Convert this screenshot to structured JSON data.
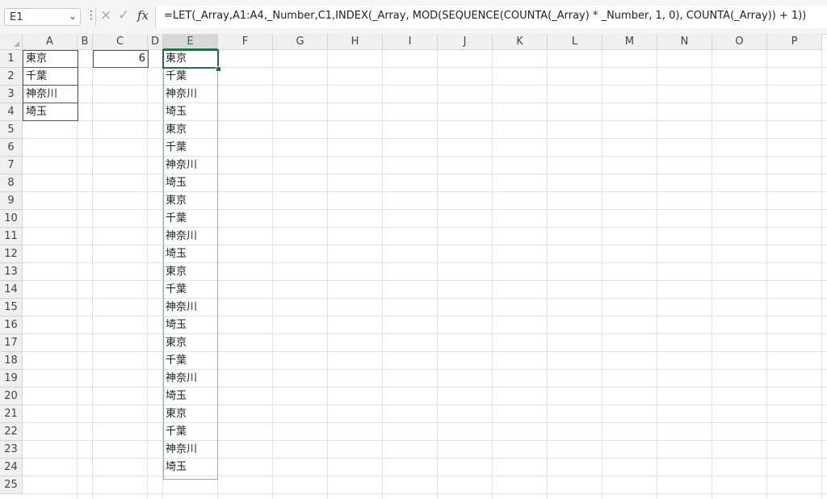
{
  "name_box": {
    "value": "E1"
  },
  "formula_bar": {
    "cancel_icon": "×",
    "enter_icon": "✓",
    "fx_label": "fx",
    "formula": "=LET(_Array,A1:A4,_Number,C1,INDEX(_Array, MOD(SEQUENCE(COUNTA(_Array) * _Number, 1, 0), COUNTA(_Array)) + 1))"
  },
  "columns": [
    "A",
    "B",
    "C",
    "D",
    "E",
    "F",
    "G",
    "H",
    "I",
    "J",
    "K",
    "L",
    "M",
    "N",
    "O",
    "P"
  ],
  "selected_column": "E",
  "rows": [
    "1",
    "2",
    "3",
    "4",
    "5",
    "6",
    "7",
    "8",
    "9",
    "10",
    "11",
    "12",
    "13",
    "14",
    "15",
    "16",
    "17",
    "18",
    "19",
    "20",
    "21",
    "22",
    "23",
    "24",
    "25"
  ],
  "column_a": [
    "東京",
    "千葉",
    "神奈川",
    "埼玉"
  ],
  "c1_value": "6",
  "column_e": [
    "東京",
    "千葉",
    "神奈川",
    "埼玉",
    "東京",
    "千葉",
    "神奈川",
    "埼玉",
    "東京",
    "千葉",
    "神奈川",
    "埼玉",
    "東京",
    "千葉",
    "神奈川",
    "埼玉",
    "東京",
    "千葉",
    "神奈川",
    "埼玉",
    "東京",
    "千葉",
    "神奈川",
    "埼玉"
  ]
}
